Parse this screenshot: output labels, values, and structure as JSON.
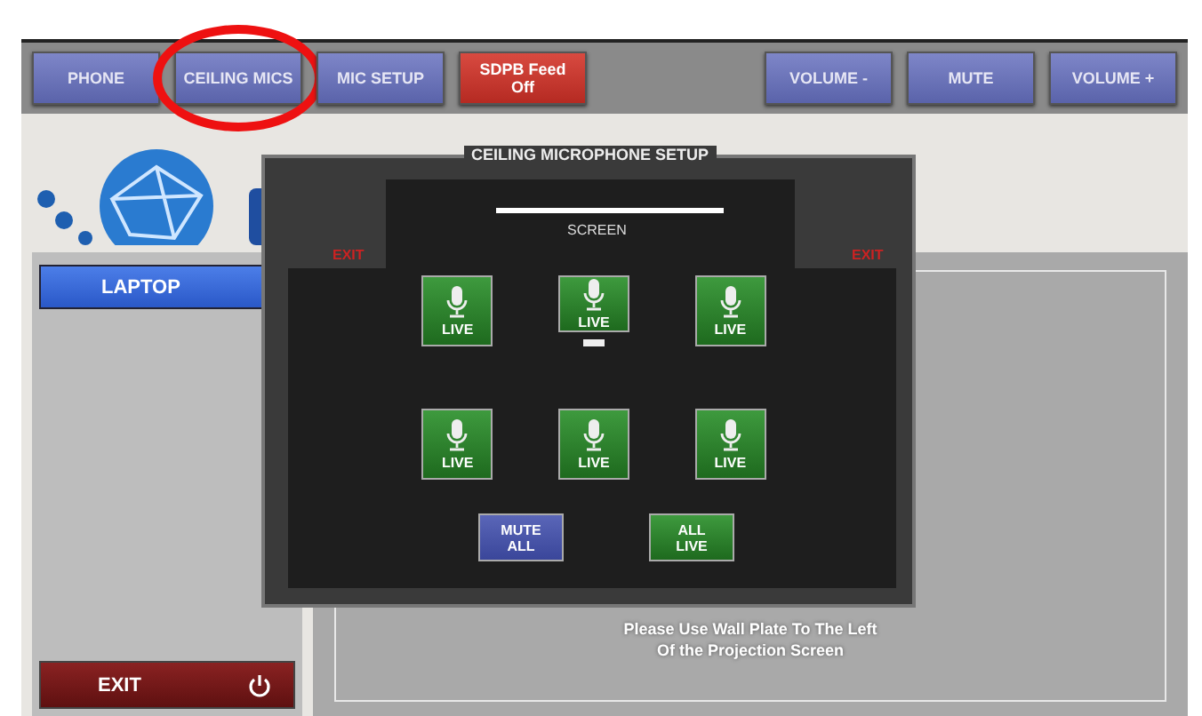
{
  "top_buttons": [
    {
      "label": "PHONE",
      "kind": "nav",
      "highlighted": false
    },
    {
      "label": "CEILING MICS",
      "kind": "nav",
      "highlighted": true
    },
    {
      "label": "MIC SETUP",
      "kind": "nav",
      "highlighted": false
    },
    {
      "label": "SDPB Feed Off",
      "kind": "alert",
      "highlighted": false
    },
    {
      "label": "VOLUME -",
      "kind": "nav",
      "highlighted": false
    },
    {
      "label": "MUTE",
      "kind": "nav",
      "highlighted": false
    },
    {
      "label": "VOLUME +",
      "kind": "nav",
      "highlighted": false
    }
  ],
  "sidebar": {
    "source": "LAPTOP",
    "exit": "EXIT"
  },
  "message": [
    "Please Use Wall Plate To The Left",
    "Of the Projection Screen"
  ],
  "dialog": {
    "title": "CEILING MICROPHONE SETUP",
    "screen": "SCREEN",
    "exit_left": "EXIT",
    "exit_right": "EXIT",
    "mics": [
      {
        "label": "LIVE",
        "live": true,
        "marker": false
      },
      {
        "label": "LIVE",
        "live": true,
        "marker": true
      },
      {
        "label": "LIVE",
        "live": true,
        "marker": false
      },
      {
        "label": "LIVE",
        "live": true,
        "marker": false
      },
      {
        "label": "LIVE",
        "live": true,
        "marker": false
      },
      {
        "label": "LIVE",
        "live": true,
        "marker": false
      }
    ],
    "mute_all": "MUTE ALL",
    "all_live": "ALL LIVE"
  }
}
